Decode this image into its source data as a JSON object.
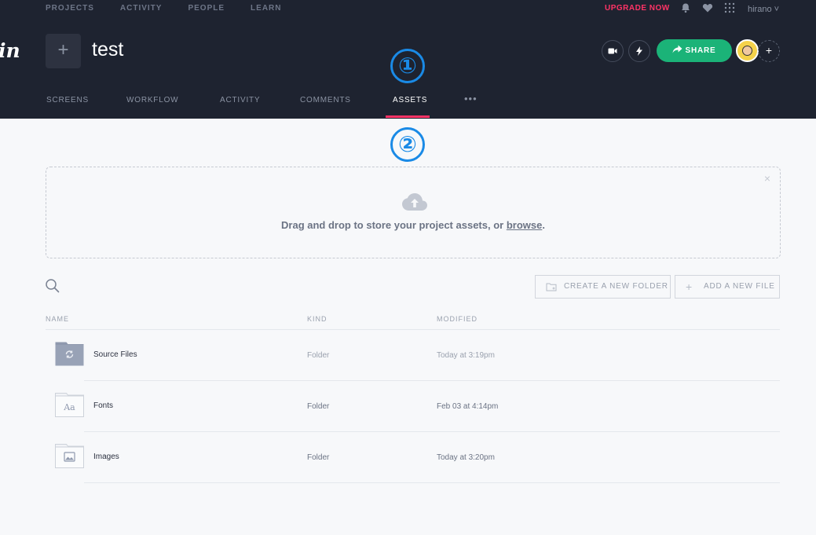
{
  "topnav": {
    "items": [
      "PROJECTS",
      "ACTIVITY",
      "PEOPLE",
      "LEARN"
    ]
  },
  "header": {
    "logo": "in",
    "add_project": "+",
    "project_title": "test",
    "upgrade": "UPGRADE NOW",
    "username": "hirano ˅",
    "share": "SHARE",
    "add_member": "+"
  },
  "tabs": [
    "SCREENS",
    "WORKFLOW",
    "ACTIVITY",
    "COMMENTS",
    "ASSETS"
  ],
  "active_tab": "ASSETS",
  "more": "•••",
  "markers": [
    "①",
    "②"
  ],
  "dropzone": {
    "text": "Drag and drop to store your project assets, or ",
    "link": "browse",
    "period": ".",
    "close": "×"
  },
  "toolbar": {
    "create_folder": "CREATE A NEW FOLDER",
    "add_file": "ADD A NEW FILE",
    "plus": "+"
  },
  "table": {
    "headers": [
      "NAME",
      "KIND",
      "MODIFIED"
    ],
    "rows": [
      {
        "name": "Source Files",
        "kind": "Folder",
        "modified": "Today at 3:19pm",
        "icon": "sync-folder-icon"
      },
      {
        "name": "Fonts",
        "kind": "Folder",
        "modified": "Feb 03 at 4:14pm",
        "icon": "font-folder-icon"
      },
      {
        "name": "Images",
        "kind": "Folder",
        "modified": "Today at 3:20pm",
        "icon": "image-folder-icon"
      }
    ]
  },
  "colors": {
    "accent_pink": "#ff3366",
    "share_green": "#1bb378",
    "header_bg": "#1e2330",
    "marker_blue": "#1a8ae6"
  }
}
